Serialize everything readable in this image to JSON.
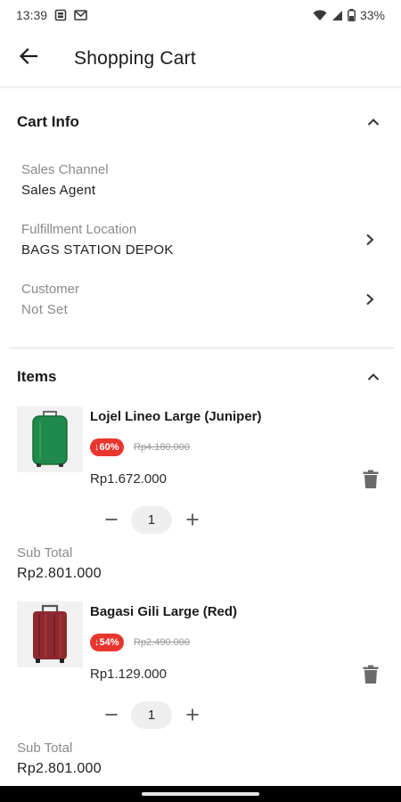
{
  "status_bar": {
    "time": "13:39",
    "battery": "33%",
    "icons": [
      "sim-card-icon",
      "gmail-icon",
      "wifi-icon",
      "signal-icon",
      "battery-icon"
    ]
  },
  "app_bar": {
    "title": "Shopping Cart",
    "back_icon": "arrow-left-icon"
  },
  "cart_info": {
    "title": "Cart Info",
    "rows": [
      {
        "label": "Sales Channel",
        "value": "Sales Agent"
      },
      {
        "label": "Fulfillment Location",
        "value": "BAGS STATION DEPOK"
      },
      {
        "label": "Customer",
        "value": "Not Set"
      }
    ]
  },
  "items_section": {
    "title": "Items",
    "items": [
      {
        "name": "Lojel Lineo Large (Juniper)",
        "discount": "↓60%",
        "original_price": "Rp4.180.000",
        "price": "Rp1.672.000",
        "quantity": "1",
        "subtotal_label": "Sub Total",
        "subtotal": "Rp2.801.000",
        "image": "green-suitcase"
      },
      {
        "name": "Bagasi Gili Large (Red)",
        "discount": "↓54%",
        "original_price": "Rp2.490.000",
        "price": "Rp1.129.000",
        "quantity": "1",
        "subtotal_label": "Sub Total",
        "subtotal": "Rp2.801.000",
        "image": "red-suitcase"
      }
    ]
  },
  "colors": {
    "discount_badge": "#e8362f",
    "green_suitcase": "#1f8a4c",
    "red_suitcase": "#8e2a2f"
  }
}
